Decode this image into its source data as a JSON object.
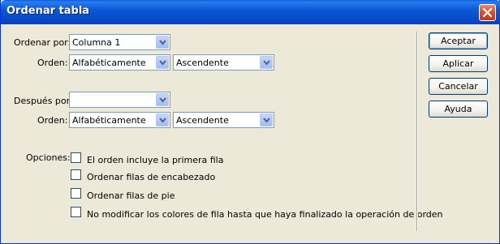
{
  "window": {
    "title": "Ordenar tabla",
    "close_icon": "close-icon"
  },
  "sort_by": {
    "label": "Ordenar por:",
    "column_value": "Columna 1",
    "order_label": "Orden:",
    "order_type": "Alfabéticamente",
    "direction": "Ascendente"
  },
  "then_by": {
    "label": "Después por:",
    "column_value": "",
    "order_label": "Orden:",
    "order_type": "Alfabéticamente",
    "direction": "Ascendente"
  },
  "options": {
    "label": "Opciones:",
    "items": [
      {
        "label": "El orden incluye la primera fila",
        "checked": false
      },
      {
        "label": "Ordenar filas de encabezado",
        "checked": false
      },
      {
        "label": "Ordenar filas de pie",
        "checked": false
      },
      {
        "label": "No modificar los colores de fila hasta que haya finalizado la operación de orden",
        "checked": false
      }
    ]
  },
  "buttons": {
    "accept": "Aceptar",
    "apply": "Aplicar",
    "cancel": "Cancelar",
    "help": "Ayuda"
  },
  "colors": {
    "titlebar": "#0a58d6",
    "dialog_bg": "#ece9d8",
    "close": "#d6512f"
  }
}
